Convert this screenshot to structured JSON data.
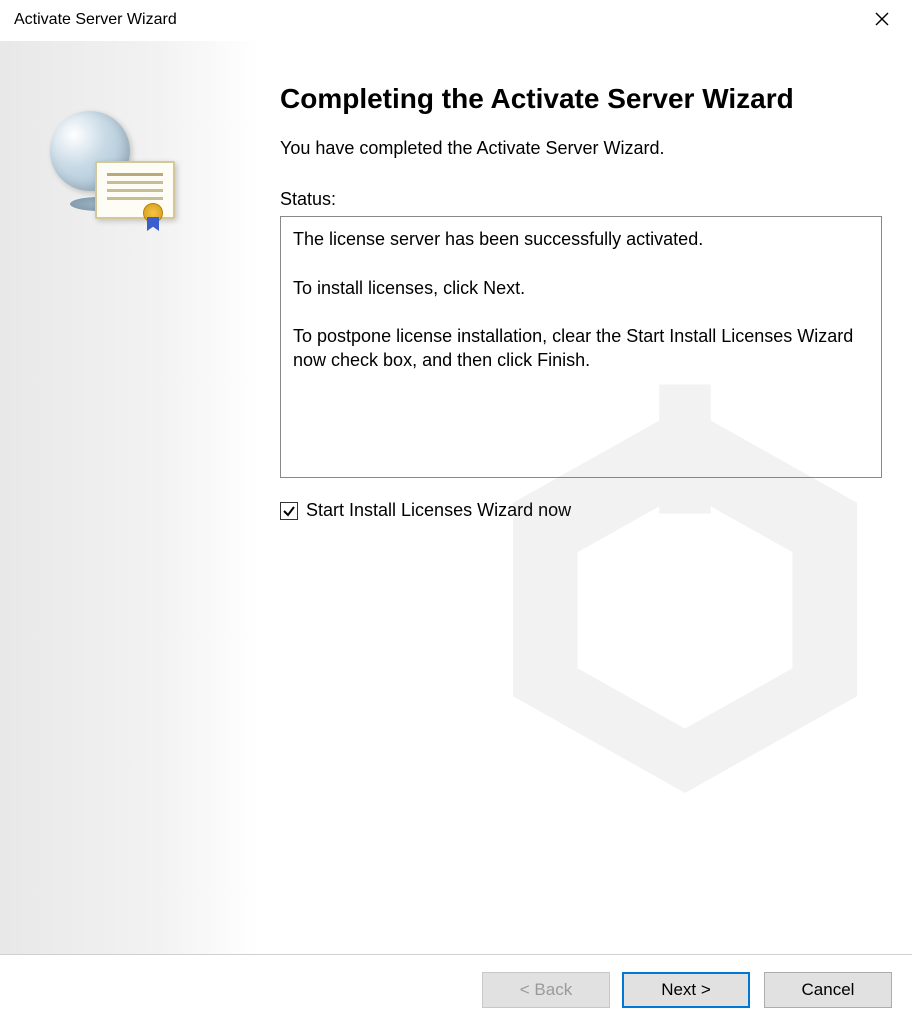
{
  "window": {
    "title": "Activate Server Wizard"
  },
  "main": {
    "heading": "Completing the Activate Server Wizard",
    "intro": "You have completed the Activate Server Wizard.",
    "status_label": "Status:",
    "status_text": "The license server has been successfully activated.\n\nTo install licenses, click Next.\n\nTo postpone license installation, clear the Start Install Licenses Wizard now check box, and then click Finish.",
    "checkbox_label": "Start Install Licenses Wizard now",
    "checkbox_checked": true
  },
  "buttons": {
    "back": "< Back",
    "next": "Next >",
    "cancel": "Cancel"
  }
}
